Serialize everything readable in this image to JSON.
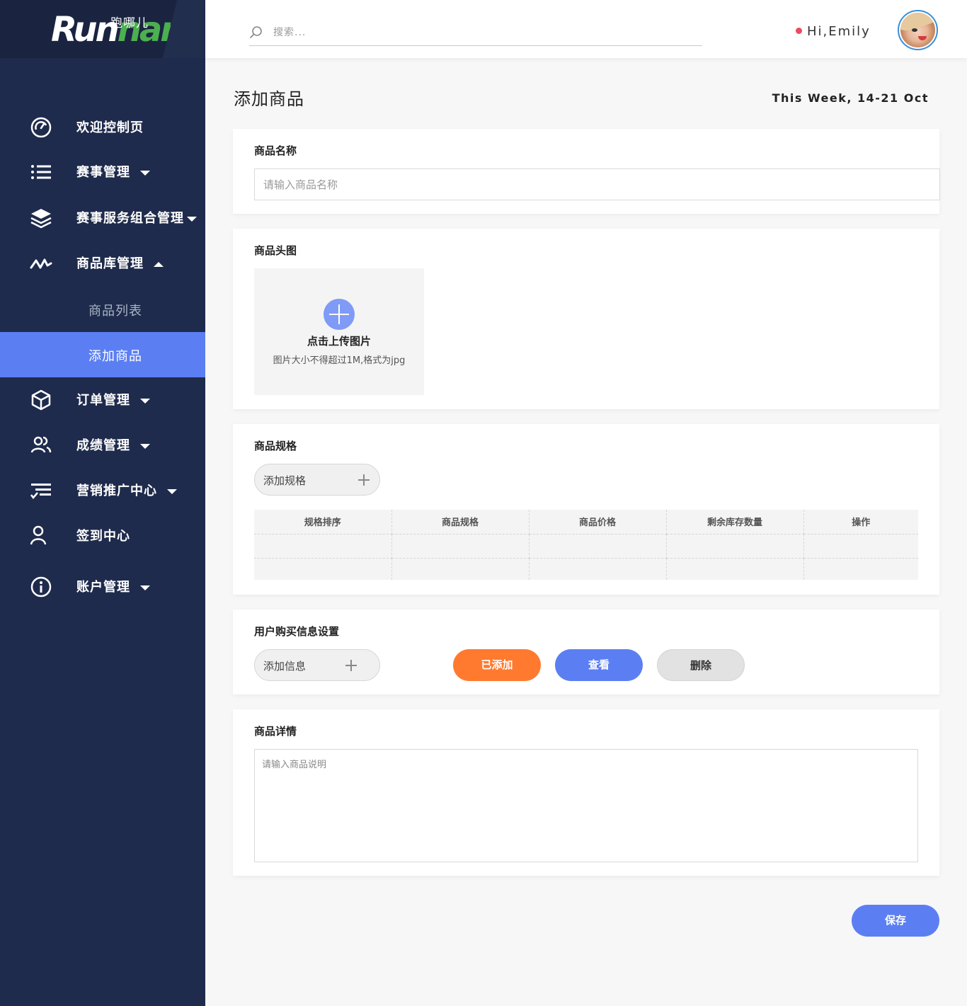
{
  "brand": {
    "logo_text_run": "Run",
    "logo_text_nar": "nar",
    "logo_cn": "跑哪儿"
  },
  "header": {
    "search_placeholder": "搜索...",
    "greeting": "Hi,Emily"
  },
  "sidebar": {
    "items": [
      {
        "label": "欢迎控制页",
        "icon": "dashboard-gauge-icon"
      },
      {
        "label": "赛事管理",
        "icon": "list-icon"
      },
      {
        "label": "赛事服务组合管理",
        "icon": "layers-icon"
      },
      {
        "label": "商品库管理",
        "icon": "activity-wave-icon"
      },
      {
        "label": "订单管理",
        "icon": "box-icon"
      },
      {
        "label": "成绩管理",
        "icon": "users-icon"
      },
      {
        "label": "营销推广中心",
        "icon": "promotion-icon"
      },
      {
        "label": "签到中心",
        "icon": "user-icon"
      },
      {
        "label": "账户管理",
        "icon": "info-icon"
      }
    ],
    "sub_items": [
      {
        "label": "商品列表"
      },
      {
        "label": "添加商品",
        "active": true
      }
    ]
  },
  "main": {
    "title": "添加商品",
    "date_range": "This Week, 14-21 Oct",
    "product_name": {
      "label": "商品名称",
      "placeholder": "请输入商品名称"
    },
    "product_image": {
      "label": "商品头图",
      "upload_title": "点击上传图片",
      "upload_hint": "图片大小不得超过1M,格式为jpg"
    },
    "spec": {
      "label": "商品规格",
      "add_button": "添加规格",
      "columns": [
        "规格排序",
        "商品规格",
        "商品价格",
        "剩余库存数量",
        "操作"
      ]
    },
    "purchase_info": {
      "label": "用户购买信息设置",
      "add_button": "添加信息",
      "added_button": "已添加",
      "view_button": "查看",
      "delete_button": "删除"
    },
    "detail": {
      "label": "商品详情",
      "placeholder": "请输入商品说明"
    },
    "save_button": "保存"
  },
  "colors": {
    "sidebar_bg": "#1f2b4c",
    "accent_blue": "#5b7ff3",
    "accent_orange": "#ff7a2f",
    "logo_green": "#4caf50",
    "status_dot": "#ec4a5c"
  }
}
